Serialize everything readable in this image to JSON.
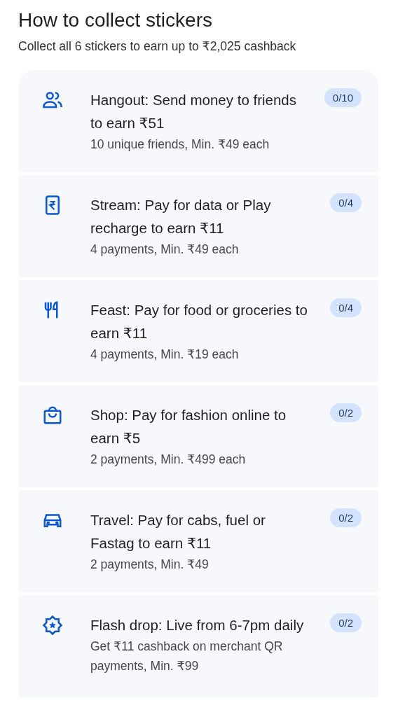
{
  "header": {
    "title": "How to collect stickers",
    "subtitle": "Collect all 6 stickers to earn up to ₹2,025 cashback"
  },
  "stickers": [
    {
      "kind": "friends",
      "title": "Hangout: Send money to friends to earn ₹51",
      "detail": "10 unique friends, Min. ₹49 each",
      "progress": "0/10"
    },
    {
      "kind": "recharge",
      "title": "Stream: Pay for data or Play recharge to earn ₹11",
      "detail": "4 payments, Min. ₹49 each",
      "progress": "0/4"
    },
    {
      "kind": "food",
      "title": "Feast: Pay for food or groceries to earn ₹11",
      "detail": "4 payments, Min. ₹19 each",
      "progress": "0/4"
    },
    {
      "kind": "shop",
      "title": "Shop: Pay for fashion online to earn ₹5",
      "detail": "2 payments, Min. ₹499 each",
      "progress": "0/2"
    },
    {
      "kind": "travel",
      "title": "Travel: Pay for cabs, fuel or Fastag to earn ₹11",
      "detail": "2 payments, Min. ₹49",
      "progress": "0/2"
    },
    {
      "kind": "flash",
      "title": "Flash drop: Live from 6-7pm daily",
      "detail": "Get ₹11 cashback on merchant QR payments, Min. ₹99",
      "progress": "0/2"
    }
  ]
}
